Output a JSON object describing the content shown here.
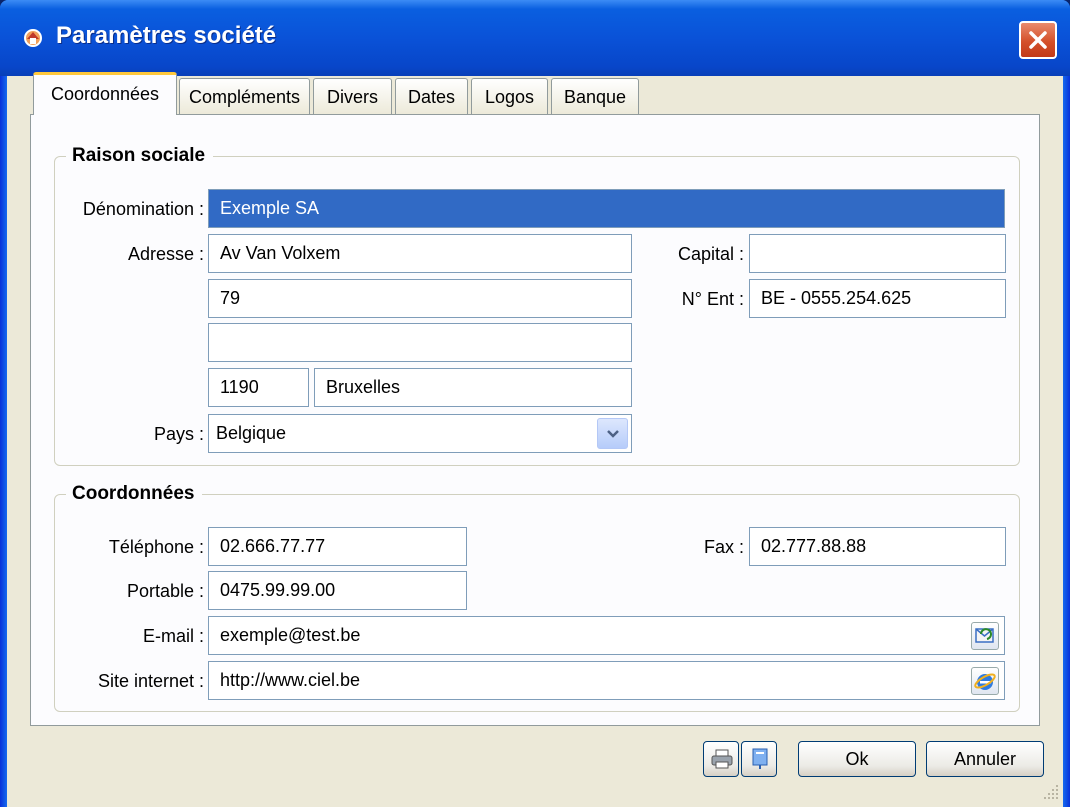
{
  "window": {
    "title": "Paramètres société",
    "close_label": "×"
  },
  "tabs": [
    {
      "label": "Coordonnées",
      "active": true
    },
    {
      "label": "Compléments",
      "active": false
    },
    {
      "label": "Divers",
      "active": false
    },
    {
      "label": "Dates",
      "active": false
    },
    {
      "label": "Logos",
      "active": false
    },
    {
      "label": "Banque",
      "active": false
    }
  ],
  "raison_sociale": {
    "title": "Raison sociale",
    "denomination_label": "Dénomination :",
    "denomination": "Exemple SA",
    "adresse_label": "Adresse :",
    "adresse1": "Av Van Volxem",
    "adresse2": "79",
    "adresse3": "",
    "code_postal": "1190",
    "ville": "Bruxelles",
    "pays_label": "Pays :",
    "pays": "Belgique",
    "capital_label": "Capital :",
    "capital": "",
    "num_ent_label": "N° Ent :",
    "num_ent": "BE - 0555.254.625"
  },
  "coordonnees": {
    "title": "Coordonnées",
    "telephone_label": "Téléphone :",
    "telephone": "02.666.77.77",
    "fax_label": "Fax :",
    "fax": "02.777.88.88",
    "portable_label": "Portable :",
    "portable": "0475.99.99.00",
    "email_label": "E-mail :",
    "email": "exemple@test.be",
    "site_label": "Site internet :",
    "site": "http://www.ciel.be"
  },
  "footer": {
    "ok_label": "Ok",
    "cancel_label": "Annuler"
  },
  "icons": [
    "app-icon",
    "close-icon",
    "chevron-down-icon",
    "email-send-icon",
    "internet-explorer-icon",
    "printer-icon",
    "help-icon",
    "resize-grip-icon"
  ],
  "colors": {
    "titlebar": "#0a52d8",
    "selection": "#316ac5",
    "tab_highlight": "#ffc83c",
    "dialog_bg": "#ece9d8"
  }
}
